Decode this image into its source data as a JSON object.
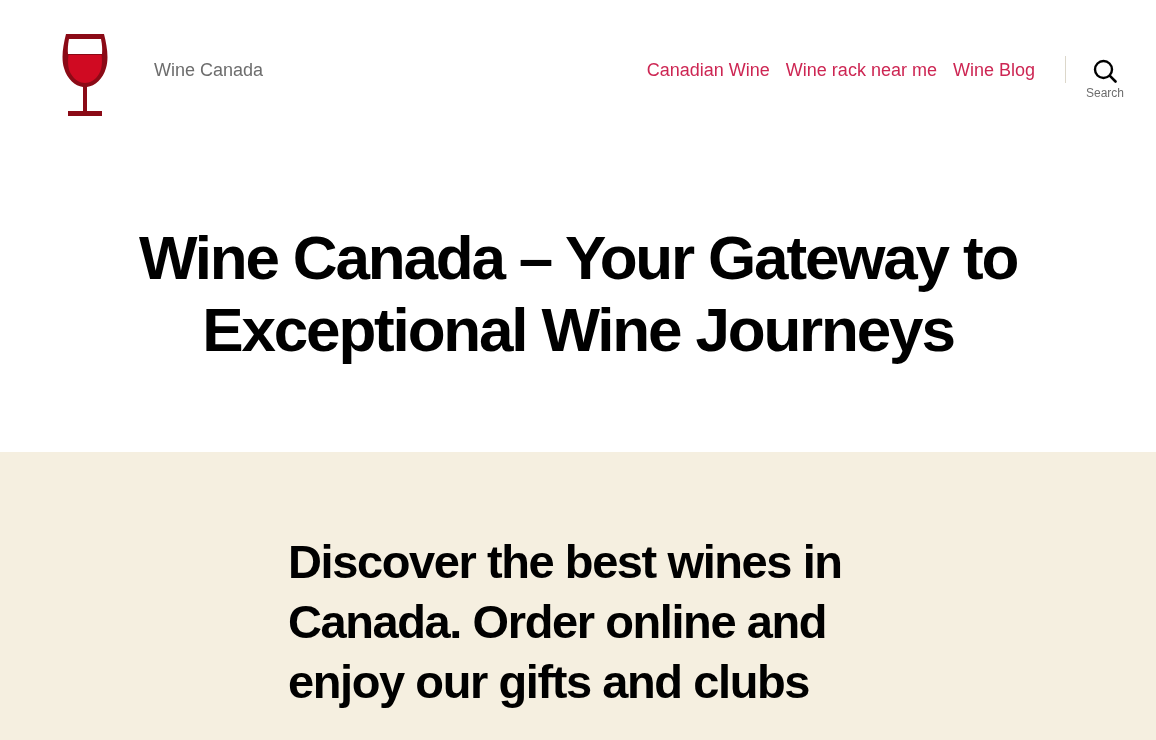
{
  "header": {
    "site_title": "Wine Canada",
    "nav": [
      "Canadian Wine",
      "Wine rack near me",
      "Wine Blog"
    ],
    "search": {
      "label": "Search"
    }
  },
  "hero": {
    "title": "Wine Canada – Your Gateway to Exceptional Wine Journeys"
  },
  "intro": {
    "text": "Discover the best wines in Canada. Order online and enjoy our gifts and clubs"
  }
}
